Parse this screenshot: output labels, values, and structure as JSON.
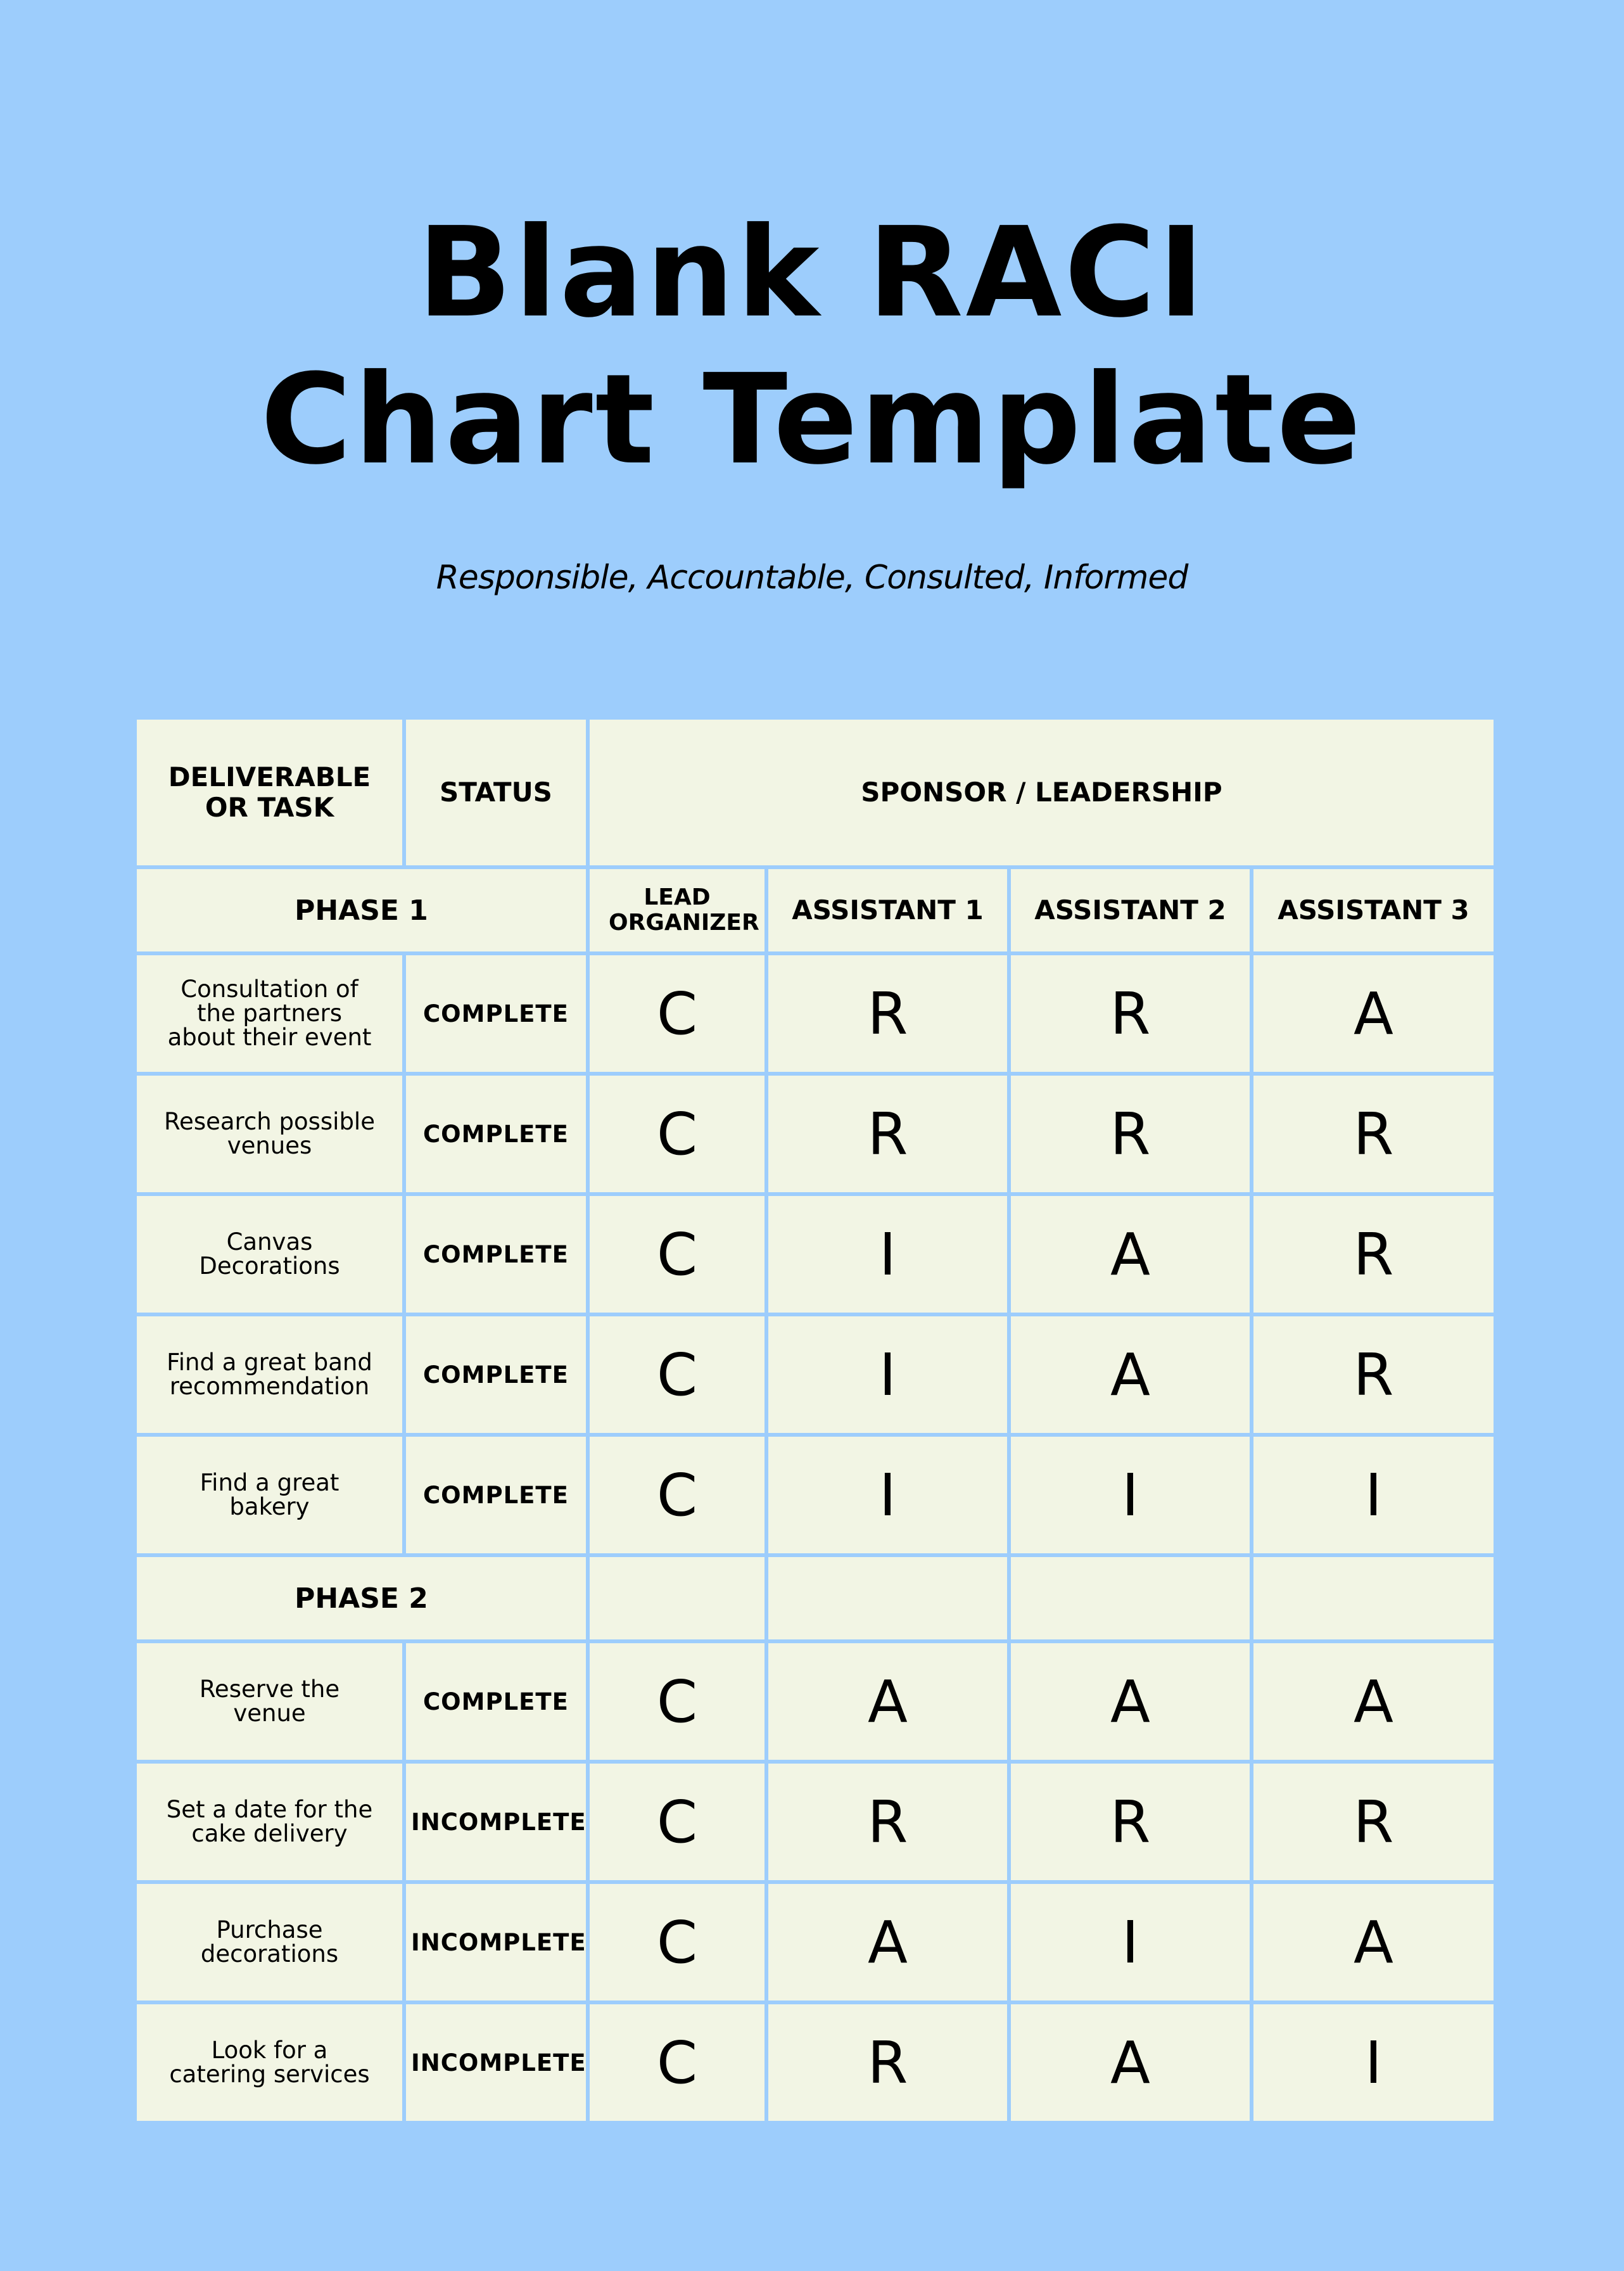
{
  "title": {
    "line1": "Blank RACI",
    "line2": "Chart Template"
  },
  "subtitle": "Responsible, Accountable, Consulted, Informed",
  "table": {
    "header": {
      "deliverable": "DELIVERABLE OR TASK",
      "status": "STATUS",
      "group": "SPONSOR / LEADERSHIP"
    },
    "roles": [
      "LEAD ORGANIZER",
      "ASSISTANT 1",
      "ASSISTANT 2",
      "ASSISTANT 3"
    ],
    "phases": [
      {
        "label": "PHASE 1",
        "rows": [
          {
            "task": "Consultation of the partners about their event",
            "status": "COMPLETE",
            "raci": [
              "C",
              "R",
              "R",
              "A"
            ]
          },
          {
            "task": "Research possible venues",
            "status": "COMPLETE",
            "raci": [
              "C",
              "R",
              "R",
              "R"
            ]
          },
          {
            "task": "Canvas Decorations",
            "status": "COMPLETE",
            "raci": [
              "C",
              "I",
              "A",
              "R"
            ]
          },
          {
            "task": "Find a great band recommendation",
            "status": "COMPLETE",
            "raci": [
              "C",
              "I",
              "A",
              "R"
            ]
          },
          {
            "task": "Find a great bakery",
            "status": "COMPLETE",
            "raci": [
              "C",
              "I",
              "I",
              "I"
            ]
          }
        ]
      },
      {
        "label": "PHASE 2",
        "rows": [
          {
            "task": "Reserve the venue",
            "status": "COMPLETE",
            "raci": [
              "C",
              "A",
              "A",
              "A"
            ]
          },
          {
            "task": "Set a date for the cake delivery",
            "status": "INCOMPLETE",
            "raci": [
              "C",
              "R",
              "R",
              "R"
            ]
          },
          {
            "task": "Purchase decorations",
            "status": "INCOMPLETE",
            "raci": [
              "C",
              "A",
              "I",
              "A"
            ]
          },
          {
            "task": "Look for a catering services",
            "status": "INCOMPLETE",
            "raci": [
              "C",
              "R",
              "A",
              "I"
            ]
          }
        ]
      }
    ]
  },
  "colors": {
    "background": "#9dcdfc",
    "cell": "#f2f5e4",
    "text": "#000000"
  }
}
